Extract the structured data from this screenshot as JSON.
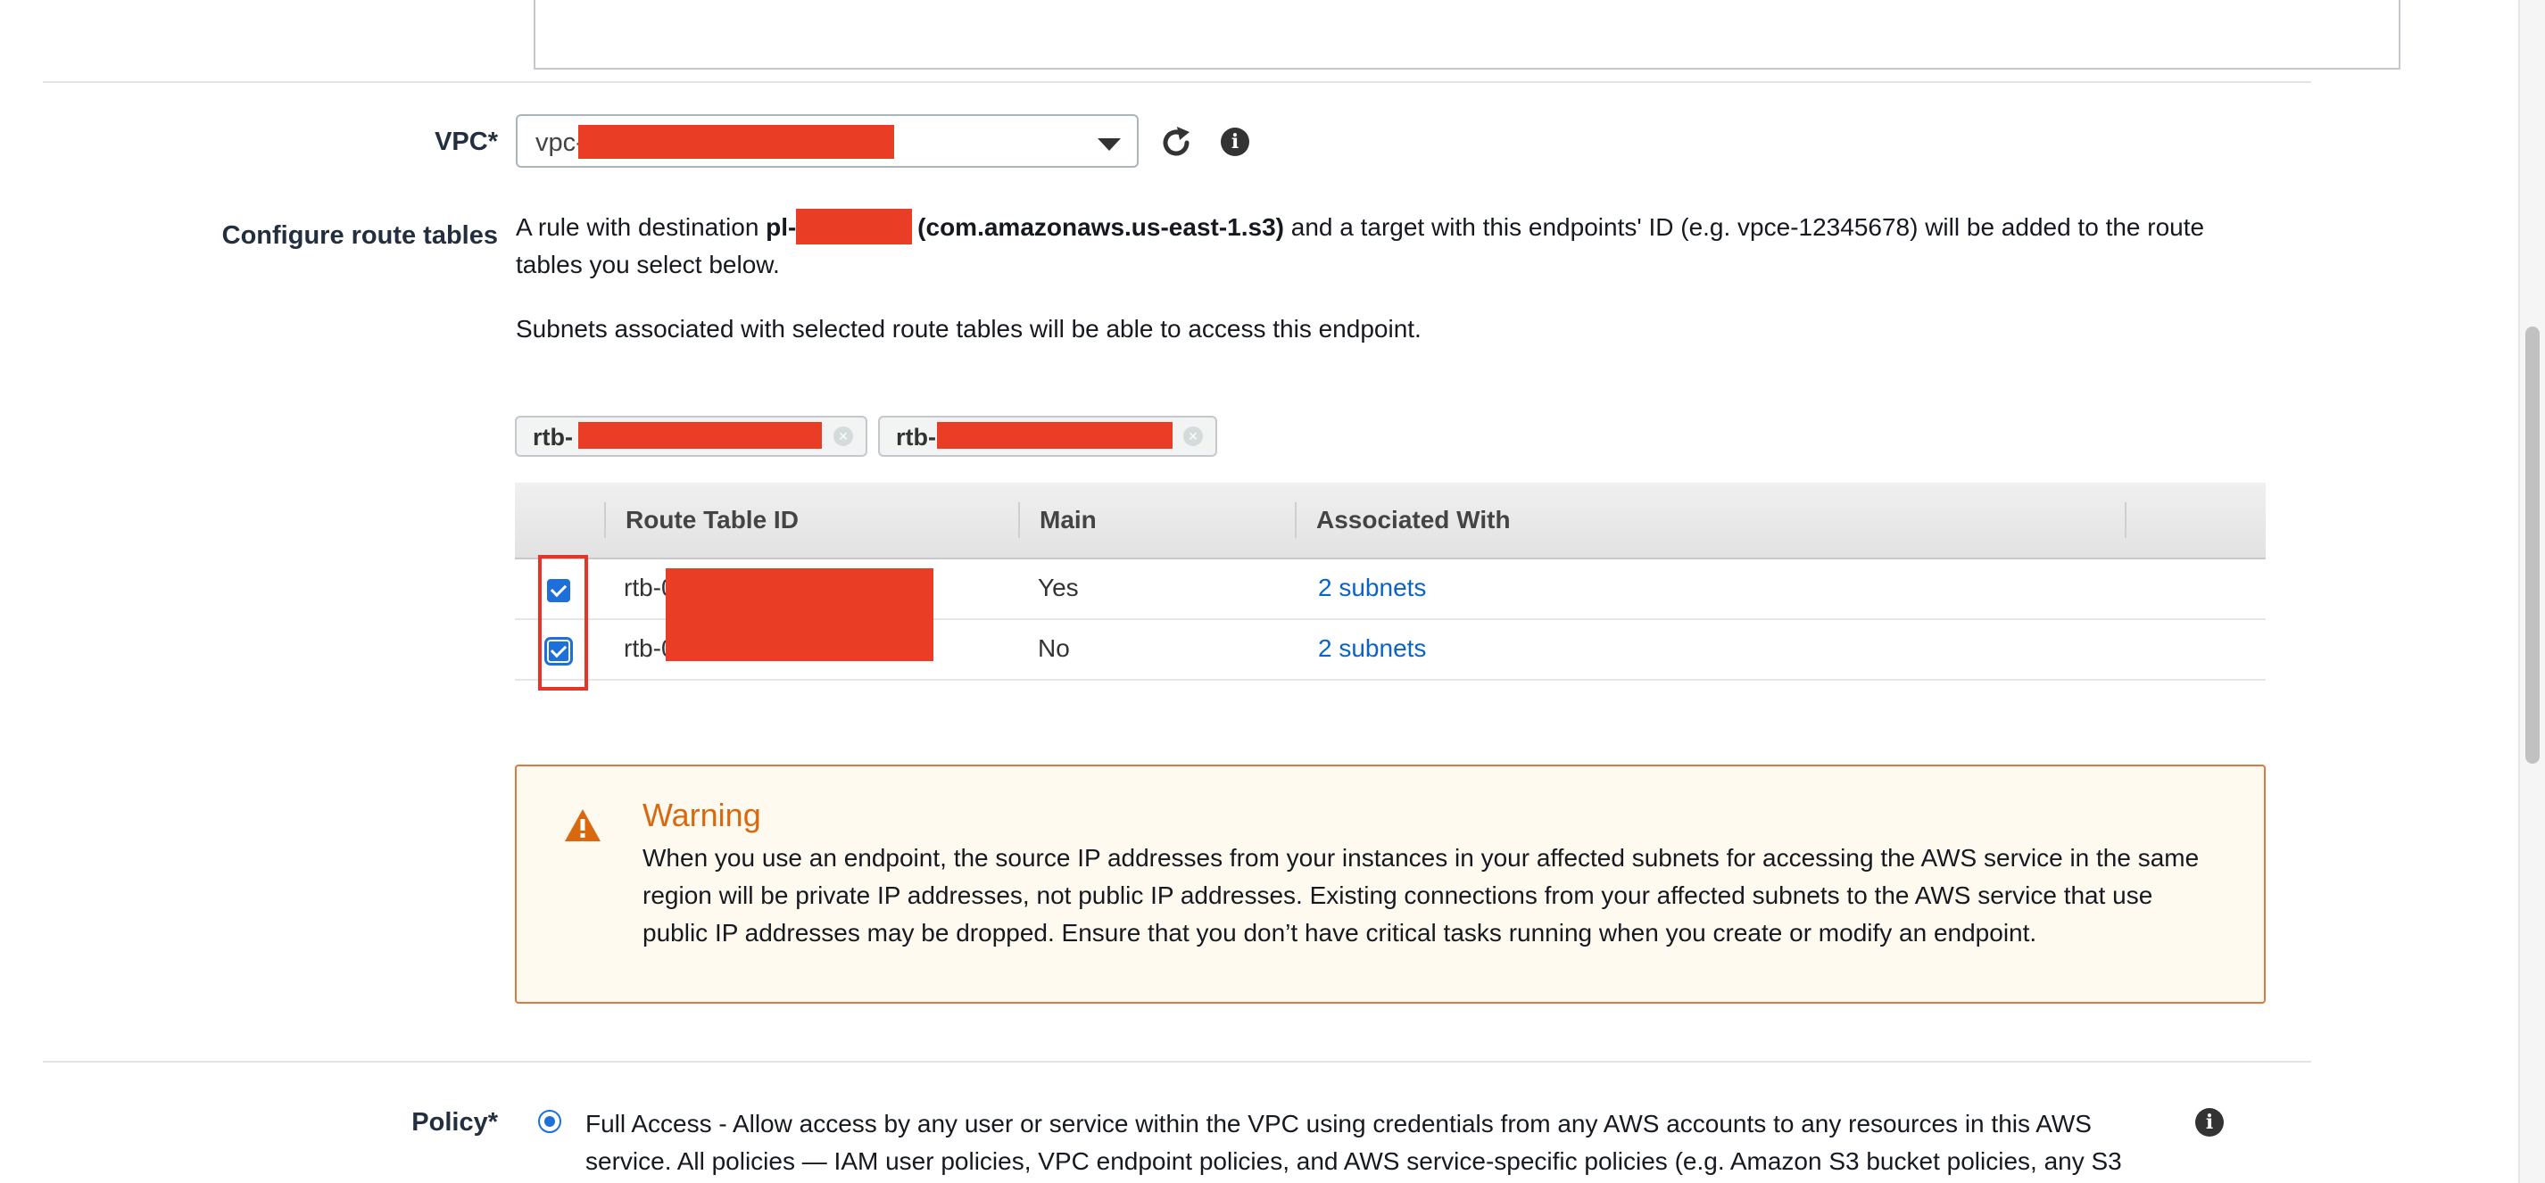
{
  "vpc": {
    "label": "VPC*",
    "value_prefix": "vpc-",
    "refresh_icon": "refresh-icon",
    "info_icon": "info-icon"
  },
  "route_tables": {
    "label": "Configure route tables",
    "rule_text_1": "A rule with destination ",
    "rule_prefix": "pl-",
    "rule_service": " (com.amazonaws.us-east-1.s3)",
    "rule_text_2": " and a target with this endpoints' ID (e.g. vpce-12345678) will be added to the route",
    "rule_text_3": "tables you select below.",
    "subnets_note": "Subnets associated with selected route tables will be able to access this endpoint.",
    "tokens": [
      "rtb-",
      "rtb-"
    ],
    "columns": [
      "Route Table ID",
      "Main",
      "Associated With"
    ],
    "rows": [
      {
        "id": "rtb-0",
        "main": "Yes",
        "associated": "2 subnets",
        "checked": true
      },
      {
        "id": "rtb-0",
        "main": "No",
        "associated": "2 subnets",
        "checked": true
      }
    ]
  },
  "warning": {
    "title": "Warning",
    "body": "When you use an endpoint, the source IP addresses from your instances in your affected subnets for accessing the AWS service in the same region will be private IP addresses, not public IP addresses. Existing connections from your affected subnets to the AWS service that use public IP addresses may be dropped. Ensure that you don’t have critical tasks running when you create or modify an endpoint.",
    "icon": "warning-icon",
    "color": "#d9680f"
  },
  "policy": {
    "label": "Policy*",
    "option_line1": "Full Access - Allow access by any user or service within the VPC using credentials from any AWS accounts to any resources in this AWS",
    "option_line2": "service. All policies — IAM user policies, VPC endpoint policies, and AWS service-specific policies (e.g. Amazon S3 bucket policies, any S3",
    "selected": true
  },
  "colors": {
    "link": "#0a64c8",
    "checkbox": "#1e6fd9",
    "redaction": "#ea3d26",
    "highlight": "#e4352a"
  }
}
